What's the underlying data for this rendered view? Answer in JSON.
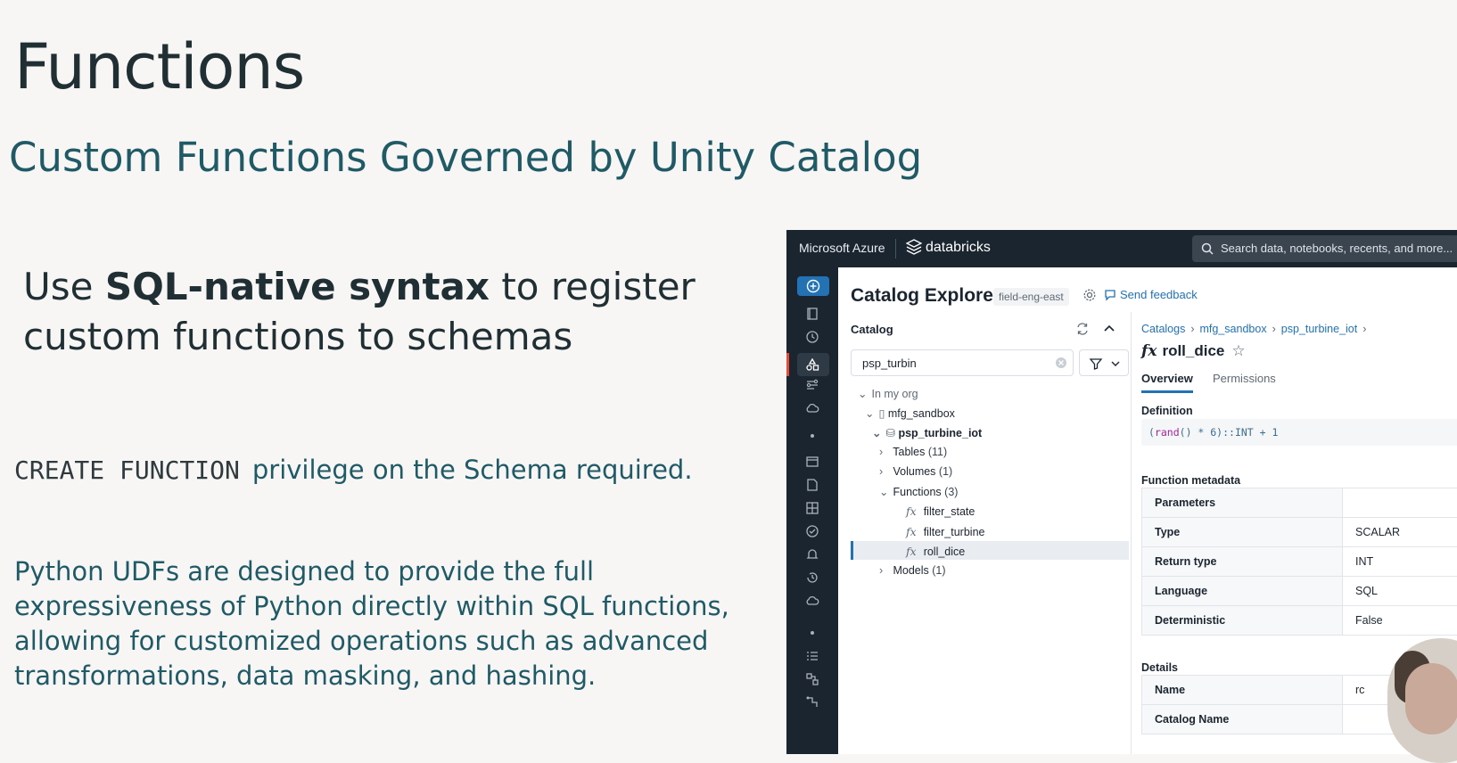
{
  "slide": {
    "title": "Functions",
    "subtitle": "Custom Functions Governed by Unity Catalog",
    "use_sql_pre": "Use ",
    "use_sql_bold": "SQL-native syntax",
    "use_sql_post": " to register custom functions to schemas",
    "privilege_code": "CREATE FUNCTION",
    "privilege_text": "privilege on the Schema required.",
    "python_text": "Python UDFs are designed to provide the full expressiveness of Python directly within SQL functions, allowing for customized operations such as advanced transformations, data masking, and hashing."
  },
  "app": {
    "brand": "Microsoft Azure",
    "product": "databricks",
    "search_placeholder": "Search data, notebooks, recents, and more...",
    "header": {
      "title": "Catalog Explorer",
      "workspace": "field-eng-east",
      "feedback": "Send feedback"
    },
    "catalog": {
      "label": "Catalog",
      "search_value": "psp_turbin",
      "tree": {
        "org": "In my org",
        "catalog": "mfg_sandbox",
        "schema": "psp_turbine_iot",
        "tables": "Tables",
        "tables_count": "(11)",
        "volumes": "Volumes",
        "volumes_count": "(1)",
        "functions": "Functions",
        "functions_count": "(3)",
        "function_items": [
          "filter_state",
          "filter_turbine",
          "roll_dice"
        ],
        "models": "Models",
        "models_count": "(1)"
      }
    },
    "detail": {
      "breadcrumb": [
        "Catalogs",
        "mfg_sandbox",
        "psp_turbine_iot"
      ],
      "function_name": "roll_dice",
      "tabs": [
        "Overview",
        "Permissions"
      ],
      "definition_label": "Definition",
      "definition_code_kw": "rand",
      "definition_code_rest": "() * 6)::INT + 1",
      "metadata_label": "Function metadata",
      "metadata": [
        {
          "k": "Parameters",
          "v": ""
        },
        {
          "k": "Type",
          "v": "SCALAR"
        },
        {
          "k": "Return type",
          "v": "INT"
        },
        {
          "k": "Language",
          "v": "SQL"
        },
        {
          "k": "Deterministic",
          "v": "False"
        }
      ],
      "details_label": "Details",
      "details": [
        {
          "k": "Name",
          "v": "rc"
        },
        {
          "k": "Catalog Name",
          "v": ""
        }
      ]
    },
    "colors": {
      "accent": "#2272b4",
      "sidebar": "#1b2530",
      "active_marker": "#e34b3b"
    }
  }
}
